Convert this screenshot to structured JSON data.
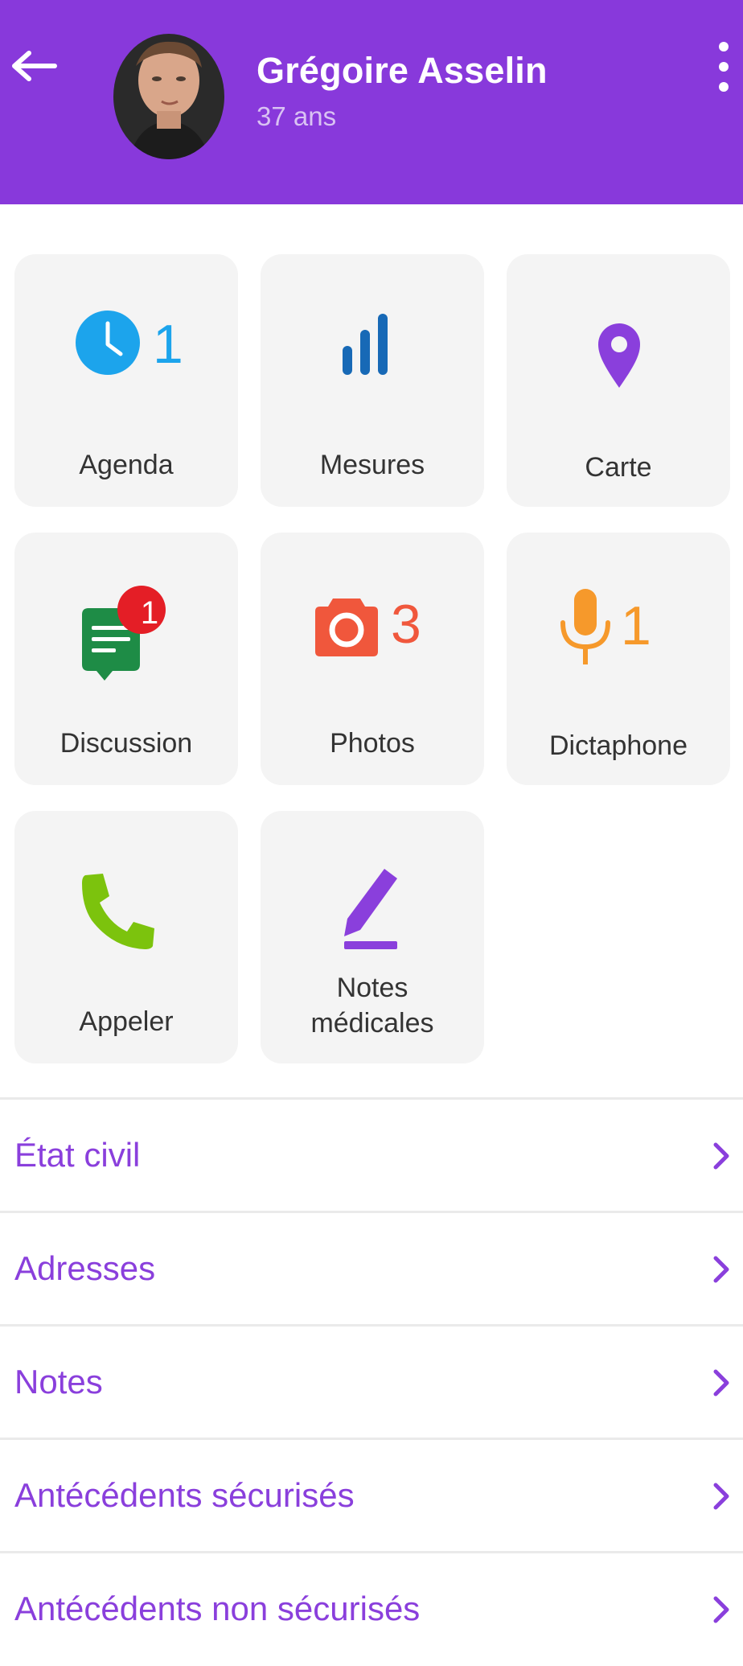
{
  "colors": {
    "header_bg": "#8839DB",
    "accent_purple": "#8A3FDC",
    "agenda_blue": "#1CA4EC",
    "measures_blue": "#1769B6",
    "discussion_green": "#1E8C46",
    "badge_red": "#E41E26",
    "photos_red": "#F0573C",
    "dictaphone_orange": "#F6992B",
    "call_green": "#7CC30D"
  },
  "header": {
    "back_icon": "arrow-left-icon",
    "name": "Grégoire Asselin",
    "age": "37 ans",
    "menu_icon": "more-vertical-icon"
  },
  "tiles": [
    {
      "label": "Agenda",
      "icon": "clock-icon",
      "count": "1"
    },
    {
      "label": "Mesures",
      "icon": "bar-chart-icon"
    },
    {
      "label": "Carte",
      "icon": "map-pin-icon"
    },
    {
      "label": "Discussion",
      "icon": "chat-icon",
      "badge": "1"
    },
    {
      "label": "Photos",
      "icon": "camera-icon",
      "count": "3"
    },
    {
      "label": "Dictaphone",
      "icon": "microphone-icon",
      "count": "1"
    },
    {
      "label": "Appeler",
      "icon": "phone-icon"
    },
    {
      "label_line1": "Notes",
      "label_line2": "médicales",
      "icon": "pencil-icon"
    }
  ],
  "list": [
    {
      "label": "État civil",
      "icon": "chevron-right-icon"
    },
    {
      "label": "Adresses",
      "icon": "chevron-right-icon"
    },
    {
      "label": "Notes",
      "icon": "chevron-right-icon"
    },
    {
      "label": "Antécédents sécurisés",
      "icon": "chevron-right-icon"
    },
    {
      "label": "Antécédents non sécurisés",
      "icon": "chevron-right-icon"
    }
  ]
}
